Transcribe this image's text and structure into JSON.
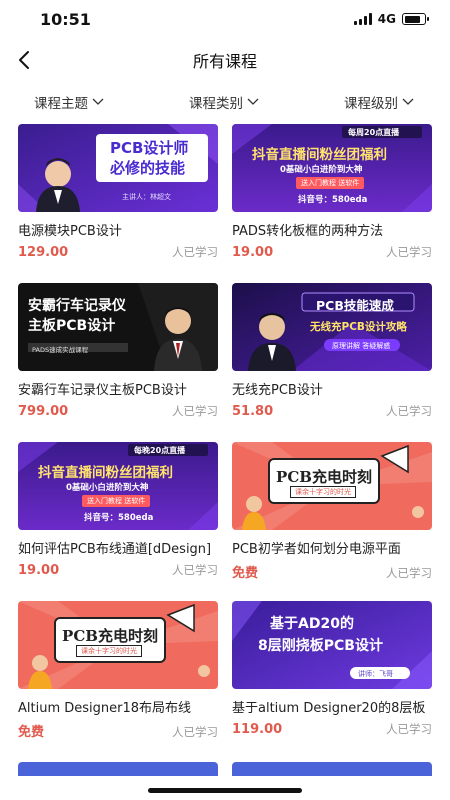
{
  "status": {
    "time": "10:51",
    "network": "4G",
    "battery_level": 0.8
  },
  "header": {
    "title": "所有课程",
    "back_icon": "chevron-left-icon"
  },
  "filters": [
    {
      "label": "课程主题"
    },
    {
      "label": "课程类别"
    },
    {
      "label": "课程级别"
    }
  ],
  "courses": [
    {
      "title": "电源模块PCB设计",
      "price": "129.00",
      "learners": "人已学习",
      "thumb": {
        "style": "purple-speaker",
        "headline": "PCB设计师",
        "headline2": "必修的技能",
        "presenter": "主讲人：林超文"
      }
    },
    {
      "title": "PADS转化板框的两种方法",
      "price": "19.00",
      "learners": "人已学习",
      "thumb": {
        "style": "purple-live",
        "top": "每周20点直播",
        "headline": "抖音直播间粉丝团福利",
        "sub": "0基础小白进阶到大神",
        "pill": "送入门教程 送软件",
        "account": "抖音号：580eda"
      }
    },
    {
      "title": "安霸行车记录仪主板PCB设计",
      "price": "799.00",
      "learners": "人已学习",
      "thumb": {
        "style": "dark-speaker",
        "headline": "安霸行车记录仪",
        "headline2": "主板PCB设计",
        "sub": "PADS速成实战课程"
      }
    },
    {
      "title": "无线充PCB设计",
      "price": "51.80",
      "learners": "人已学习",
      "thumb": {
        "style": "violet-speaker",
        "headline": "PCB技能速成",
        "headline2": "无线充PCB设计攻略",
        "sub": "原理讲解  答疑解惑"
      }
    },
    {
      "title": "如何评估PCB布线通道[dDesign]",
      "price": "19.00",
      "learners": "人已学习",
      "thumb": {
        "style": "purple-live",
        "top": "每晚20点直播",
        "headline": "抖音直播间粉丝团福利",
        "sub": "0基础小白进阶到大神",
        "pill": "送入门教程 送软件",
        "account": "抖音号：580eda"
      }
    },
    {
      "title": "PCB初学者如何划分电源平面",
      "price": "免费",
      "learners": "人已学习",
      "thumb": {
        "style": "coral-charge",
        "headline": "PCB充电时刻",
        "sub": "课余十字习的时光"
      }
    },
    {
      "title": "Altium Designer18布局布线",
      "price": "免费",
      "learners": "人已学习",
      "thumb": {
        "style": "coral-charge",
        "headline": "PCB充电时刻",
        "sub": "课余十字习的时光"
      }
    },
    {
      "title": "基于altium Designer20的8层板",
      "price": "119.00",
      "learners": "人已学习",
      "thumb": {
        "style": "purple-board",
        "headline": "基于AD20的",
        "headline2": "8层刚挠板PCB设计",
        "presenter": "讲师：飞哥"
      }
    }
  ],
  "colors": {
    "price": "#e05a4e",
    "muted": "#999999",
    "accent": "#5b3cc4"
  }
}
